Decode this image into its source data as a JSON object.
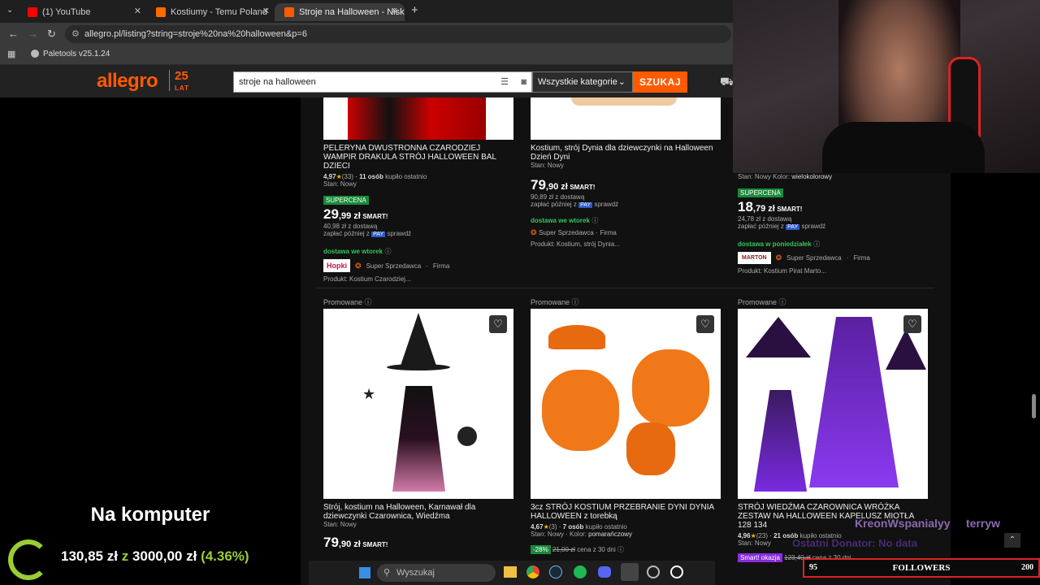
{
  "browser": {
    "tabs": [
      {
        "label": "(1) YouTube",
        "color": "#ff0000"
      },
      {
        "label": "Kostiumy - Temu Poland",
        "color": "#ff6a00"
      },
      {
        "label": "Stroje na Halloween - Niska ce",
        "color": "#ff5a00"
      }
    ],
    "url": "allegro.pl/listing?string=stroje%20na%20halloween&p=6",
    "bookmark": "Paletools v25.1.24"
  },
  "allegro": {
    "logo": "allegro",
    "logo_25": "25",
    "logo_lat": "LAT",
    "search_value": "stroje na halloween",
    "category": "Wszystkie kategorie",
    "search_button": "SZUKAJ"
  },
  "top_cards": [
    {
      "title": "PELERYNA DWUSTRONNA CZARODZIEJ WAMPIR DRAKULA STRÓJ HALLOWEEN BAL DZIECI",
      "rating": "4,97",
      "reviews": "(33)",
      "bought": "11 osób",
      "bought_suffix": "kupiło ostatnio",
      "state": "Stan: Nowy",
      "badge": "SUPERCENA",
      "price_main": "29",
      "price_dec": ",99 zł",
      "smart": "SMART!",
      "delivery_price": "40,98 zł z dostawą",
      "pay_later": "zapłać później z",
      "pay_tag": "PAY",
      "pay_check": "sprawdź",
      "delivery": "dostawa we wtorek",
      "seller_logo": "Hopki",
      "seller": "Super Sprzedawca",
      "firm": "Firma",
      "product": "Produkt: Kostium Czarodziej..."
    },
    {
      "title": "Kostium, strój Dynia dla dziewczynki na Halloween Dzień Dyni",
      "state": "Stan: Nowy",
      "price_main": "79",
      "price_dec": ",90 zł",
      "smart": "SMART!",
      "delivery_price": "90,89 zł z dostawą",
      "pay_later": "zapłać później z",
      "pay_tag": "PAY",
      "pay_check": "sprawdź",
      "delivery": "dostawa we wtorek",
      "seller": "Super Sprzedawca",
      "firm": "Firma",
      "product": "Produkt: Kostium, strój Dynia..."
    },
    {
      "state": "Stan: Nowy",
      "color_label": "Kolor:",
      "color_value": "wielokolorowy",
      "badge": "SUPERCENA",
      "price_main": "18",
      "price_dec": ",79 zł",
      "smart": "SMART!",
      "delivery_price": "24,78 zł z dostawą",
      "pay_later": "zapłać później z",
      "pay_tag": "PAY",
      "pay_check": "sprawdź",
      "delivery": "dostawa w poniedziałek",
      "seller_logo": "MARTON",
      "seller": "Super Sprzedawca",
      "firm": "Firma",
      "product": "Produkt: Kostium Pirat Marto..."
    }
  ],
  "bottom_cards": [
    {
      "promo": "Promowane",
      "title": "Strój, kostium na Halloween, Karnawał dla dziewczynki Czarownica, Wiedźma",
      "state": "Stan: Nowy",
      "price_main": "79",
      "price_dec": ",90 zł",
      "smart": "SMART!"
    },
    {
      "promo": "Promowane",
      "title": "3cz STRÓJ KOSTIUM PRZEBRANIE DYNI DYNIA HALLOWEEN z torebką",
      "rating": "4,67",
      "reviews": "(3)",
      "bought": "7 osób",
      "bought_suffix": "kupiło ostatnio",
      "state": "Stan: Nowy",
      "color_label": "Kolor:",
      "color_value": "pomarańczowy",
      "discount": "-28%",
      "old_price": "21,00 zł",
      "old_note": "cena z 30 dni"
    },
    {
      "promo": "Promowane",
      "title": "STRÓJ WIEDŹMA CZAROWNICA WRÓŻKA ZESTAW NA HALLOWEEN KAPELUSZ MIOTŁA 128 134",
      "rating": "4,96",
      "reviews": "(23)",
      "bought": "21 osób",
      "bought_suffix": "kupiło ostatnio",
      "state": "Stan: Nowy",
      "smart_badge": "Smart! okazja",
      "old_price": "123,40 zł",
      "old_note": "cena z 30 dni"
    }
  ],
  "overlay": {
    "headline": "Na komputer",
    "amount": "130,85 zł",
    "z": "z",
    "goal": "3000,00 zł",
    "percent": "(4.36%)",
    "scroll_names": "KreonWspanialyy     terryw",
    "last_donator": "Ostatni Donator: No data",
    "followers_left": "95",
    "followers_label": "FOLLOWERS",
    "followers_right": "200"
  },
  "taskbar": {
    "search_placeholder": "Wyszukaj"
  }
}
